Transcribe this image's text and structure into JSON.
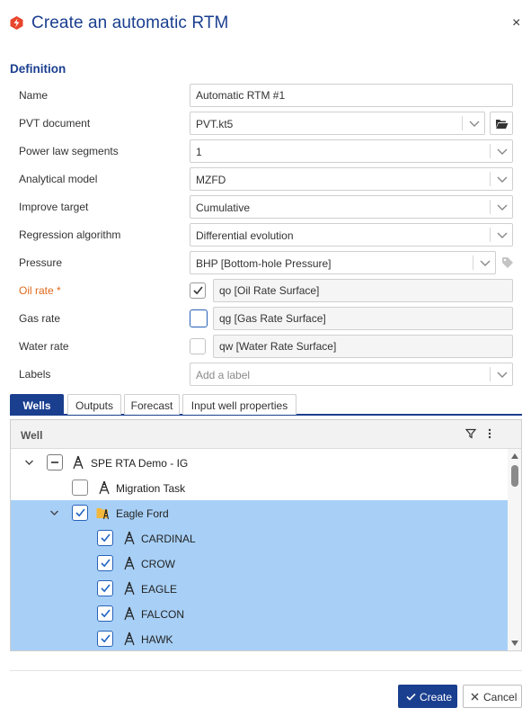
{
  "dialog": {
    "title": "Create an automatic RTM",
    "close_symbol": "×",
    "app_icon": "ke-logo-icon",
    "accent_color": "#1b3f8f",
    "required_color": "#e06a1e",
    "selection_color": "#a8d0f7"
  },
  "definition": {
    "section_title": "Definition",
    "name": {
      "label": "Name",
      "value": "Automatic RTM #1"
    },
    "pvt_document": {
      "label": "PVT document",
      "value": "PVT.kt5"
    },
    "power_law_segments": {
      "label": "Power law segments",
      "value": "1"
    },
    "analytical_model": {
      "label": "Analytical model",
      "value": "MZFD"
    },
    "improve_target": {
      "label": "Improve target",
      "value": "Cumulative"
    },
    "regression_algorithm": {
      "label": "Regression algorithm",
      "value": "Differential evolution"
    },
    "pressure": {
      "label": "Pressure",
      "value": "BHP [Bottom-hole Pressure]"
    },
    "oil_rate": {
      "label": "Oil rate *",
      "checked": true,
      "value": "qo [Oil Rate Surface]"
    },
    "gas_rate": {
      "label": "Gas rate",
      "checked": false,
      "value": "qg [Gas Rate Surface]"
    },
    "water_rate": {
      "label": "Water rate",
      "checked": false,
      "value": "qw [Water Rate Surface]"
    },
    "labels": {
      "label": "Labels",
      "placeholder": "Add a label"
    }
  },
  "tabs": [
    {
      "label": "Wells",
      "active": true
    },
    {
      "label": "Outputs",
      "active": false
    },
    {
      "label": "Forecast",
      "active": false
    },
    {
      "label": "Input well properties",
      "active": false
    }
  ],
  "grid": {
    "column_header": "Well",
    "rows": [
      {
        "label": "SPE RTA Demo - IG",
        "type": "project",
        "expanded": true,
        "check_state": "indeterminate",
        "selected": false
      },
      {
        "label": "Migration Task",
        "type": "well",
        "check_state": "unchecked",
        "selected": false
      },
      {
        "label": "Eagle Ford",
        "type": "folder",
        "expanded": true,
        "check_state": "checked",
        "selected": true
      },
      {
        "label": "CARDINAL",
        "type": "well",
        "check_state": "checked",
        "selected": true
      },
      {
        "label": "CROW",
        "type": "well",
        "check_state": "checked",
        "selected": true
      },
      {
        "label": "EAGLE",
        "type": "well",
        "check_state": "checked",
        "selected": true
      },
      {
        "label": "FALCON",
        "type": "well",
        "check_state": "checked",
        "selected": true
      },
      {
        "label": "HAWK",
        "type": "well",
        "check_state": "checked",
        "selected": true
      }
    ]
  },
  "footer": {
    "create_label": "Create",
    "cancel_label": "Cancel"
  }
}
